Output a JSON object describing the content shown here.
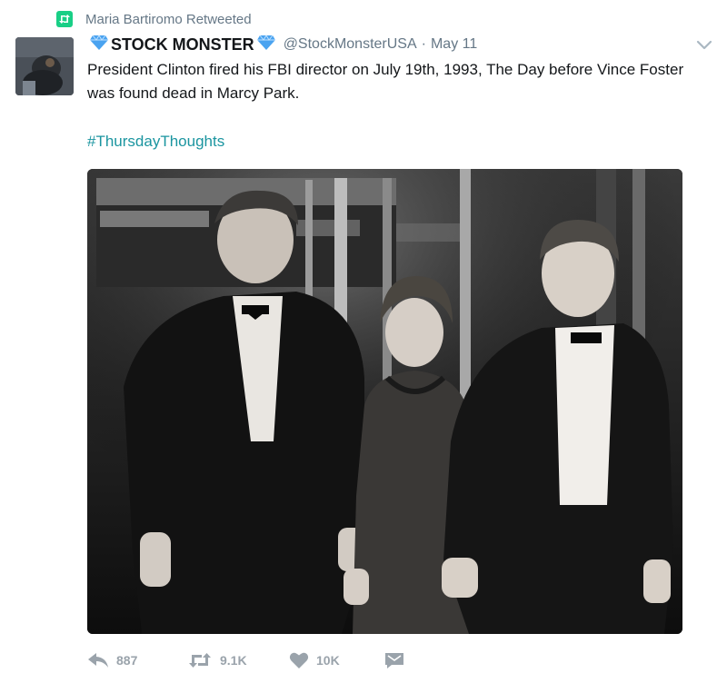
{
  "retweet": {
    "label": "Maria Bartiromo Retweeted"
  },
  "author": {
    "display_name": "STOCK MONSTER",
    "handle": "@StockMonsterUSA",
    "separator": "·",
    "timestamp": "May 11"
  },
  "tweet": {
    "text": "President Clinton fired his FBI director on July 19th, 1993, The Day before Vince Foster was found dead in Marcy Park.",
    "hashtag": "#ThursdayThoughts"
  },
  "actions": {
    "reply_count": "887",
    "retweet_count": "9.1K",
    "like_count": "10K"
  },
  "colors": {
    "retweet_green": "#19cf86",
    "hashtag_teal": "#1b95a0",
    "muted_gray": "#657786",
    "action_gray": "#9aa3ab",
    "diamond_blue": "#4aa3f0"
  },
  "icons": [
    "retweet-icon",
    "blue-diamond-icon",
    "chevron-down-icon",
    "reply-icon",
    "like-icon",
    "direct-message-icon"
  ]
}
